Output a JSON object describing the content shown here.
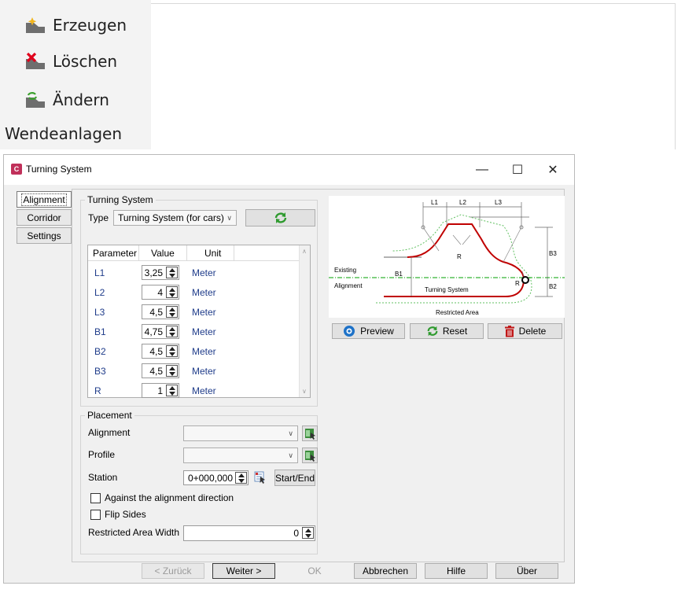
{
  "ribbon": {
    "items": [
      {
        "label": "Erzeugen",
        "icon": "create-icon"
      },
      {
        "label": "Löschen",
        "icon": "delete-icon"
      },
      {
        "label": "Ändern",
        "icon": "modify-icon"
      }
    ],
    "group_label": "Wendeanlagen"
  },
  "window": {
    "title": "Turning System",
    "app_icon_letter": "C",
    "controls": {
      "minimize": "—",
      "maximize": "☐",
      "close": "✕"
    }
  },
  "tabs": [
    {
      "label": "Alignment",
      "active": true
    },
    {
      "label": "Corridor",
      "active": false
    },
    {
      "label": "Settings",
      "active": false
    }
  ],
  "turning_system": {
    "group_label": "Turning System",
    "type_label": "Type",
    "type_value": "Turning System (for cars)",
    "refresh_icon": "refresh-icon",
    "columns": [
      "Parameter",
      "Value",
      "Unit"
    ],
    "rows": [
      {
        "name": "L1",
        "value": "3,25",
        "unit": "Meter"
      },
      {
        "name": "L2",
        "value": "4",
        "unit": "Meter"
      },
      {
        "name": "L3",
        "value": "4,5",
        "unit": "Meter"
      },
      {
        "name": "B1",
        "value": "4,75",
        "unit": "Meter"
      },
      {
        "name": "B2",
        "value": "4,5",
        "unit": "Meter"
      },
      {
        "name": "B3",
        "value": "4,5",
        "unit": "Meter"
      },
      {
        "name": "R",
        "value": "1",
        "unit": "Meter"
      }
    ]
  },
  "placement": {
    "group_label": "Placement",
    "alignment_label": "Alignment",
    "alignment_value": "",
    "profile_label": "Profile",
    "profile_value": "",
    "station_label": "Station",
    "station_value": "0+000,000",
    "start_end_label": "Start/End",
    "against_label": "Against the alignment direction",
    "against_checked": false,
    "flip_label": "Flip Sides",
    "flip_checked": false,
    "restricted_label": "Restricted Area Width",
    "restricted_value": "0"
  },
  "diagram": {
    "labels": {
      "L1": "L1",
      "L2": "L2",
      "L3": "L3",
      "B1": "B1",
      "B2": "B2",
      "B3": "B3",
      "R": "R",
      "existing": "Existing",
      "alignment": "Alignment",
      "turning_system": "Turning System",
      "restricted_area": "Restricted Area"
    },
    "colors": {
      "turning_line": "#c00000",
      "alignment_line": "#00a000",
      "restricted_line": "#60c060"
    }
  },
  "actions": {
    "preview": "Preview",
    "reset": "Reset",
    "delete": "Delete"
  },
  "footer": {
    "back": "< Zurück",
    "next": "Weiter >",
    "ok": "OK",
    "cancel": "Abbrechen",
    "help": "Hilfe",
    "about": "Über"
  }
}
